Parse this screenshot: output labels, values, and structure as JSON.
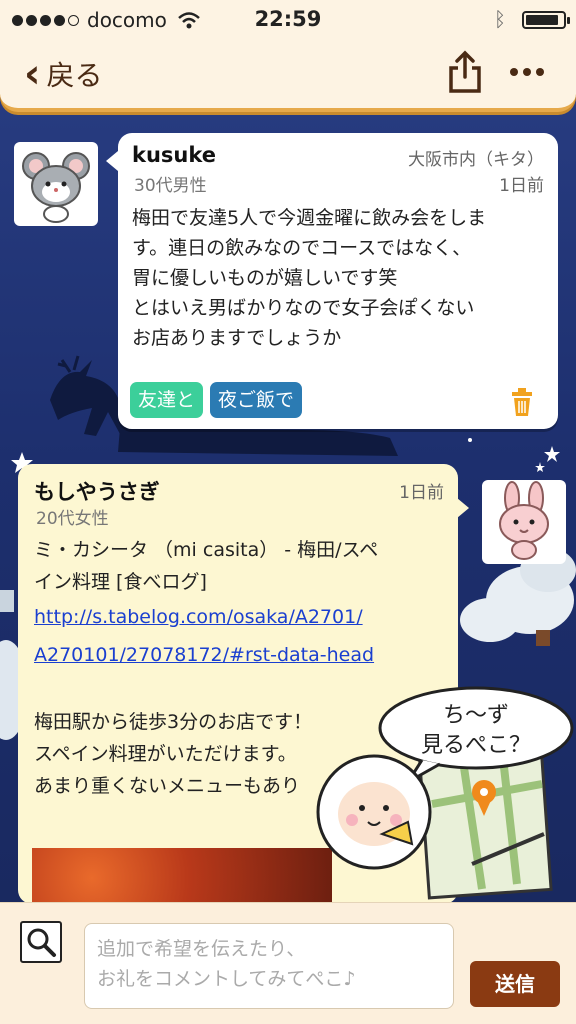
{
  "status_bar": {
    "carrier": "docomo",
    "time": "22:59",
    "battery_level": 0.9
  },
  "nav": {
    "back_label": "戻る",
    "back_icon": "chevron-left-icon",
    "share_icon": "share-icon",
    "more_icon": "more-icon"
  },
  "post": {
    "username": "kusuke",
    "location": "大阪市内（キタ）",
    "demographic": "30代男性",
    "time": "1日前",
    "body_lines": [
      "梅田で友達5人で今週金曜に飲み会をしま",
      "す。連日の飲みなのでコースではなく、",
      "胃に優しいものが嬉しいです笑",
      "とはいえ男ばかりなので女子会ぽくない",
      "お店ありますでしょうか"
    ],
    "tags": [
      "友達と",
      "夜ご飯で"
    ],
    "avatar_icon": "mouse-avatar-icon",
    "delete_icon": "trash-icon"
  },
  "reply": {
    "username": "もしやうさぎ",
    "time": "1日前",
    "demographic": "20代女性",
    "title_lines": [
      "ミ・カシータ （mi casita） - 梅田/スペ",
      "イン料理 [食べログ]"
    ],
    "link_lines": [
      "http://s.tabelog.com/osaka/A2701/",
      "A270101/27078172/#rst-data-head"
    ],
    "body_lines": [
      "梅田駅から徒歩3分のお店です！",
      "スペイン料理がいただけます。",
      "あまり重くないメニューもあり"
    ],
    "avatar_icon": "rabbit-avatar-icon"
  },
  "mascot": {
    "speech": [
      "ち〜ず",
      "見るぺこ？"
    ],
    "icon": "sheep-map-mascot-icon"
  },
  "composer": {
    "placeholder": "追加で希望を伝えたり、\nお礼をコメントしてみてぺこ♪",
    "send_label": "送信",
    "search_icon": "search-icon"
  },
  "colors": {
    "header_bg": "#fdf3e3",
    "header_border": "#e6a94b",
    "tag_friends": "#3ccf9a",
    "tag_dinner": "#2b7bb3",
    "reply_bg": "#fdf7d2",
    "send_bg": "#8a3a12",
    "link": "#1a3fd0"
  }
}
